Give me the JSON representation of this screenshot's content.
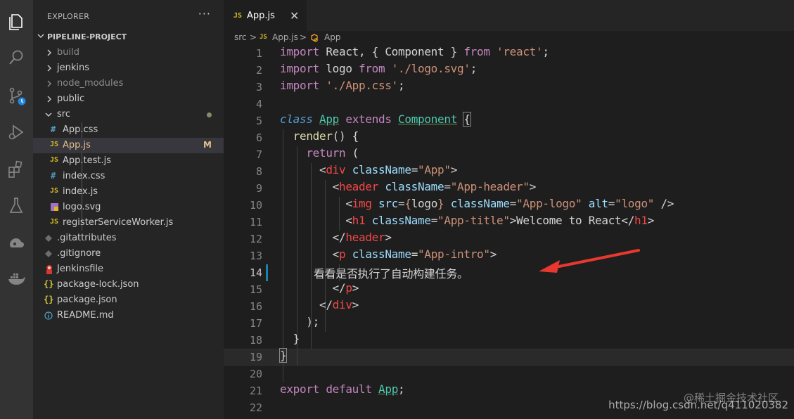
{
  "activity_bar": {
    "icons": [
      "files-icon",
      "search-icon",
      "source-control-icon",
      "run-debug-icon",
      "extensions-icon",
      "testing-icon",
      "database-icon",
      "docker-icon"
    ]
  },
  "explorer": {
    "header": "EXPLORER",
    "more": "···",
    "project": "PIPELINE-PROJECT",
    "items": [
      {
        "name": "build",
        "type": "folder",
        "state": "collapsed"
      },
      {
        "name": "jenkins",
        "type": "folder",
        "state": "collapsed"
      },
      {
        "name": "node_modules",
        "type": "folder",
        "state": "collapsed"
      },
      {
        "name": "public",
        "type": "folder",
        "state": "collapsed"
      },
      {
        "name": "src",
        "type": "folder",
        "state": "expanded"
      },
      {
        "name": "App.css",
        "type": "css",
        "icon": "#"
      },
      {
        "name": "App.js",
        "type": "js",
        "icon": "JS",
        "badge": "M"
      },
      {
        "name": "App.test.js",
        "type": "js",
        "icon": "JS"
      },
      {
        "name": "index.css",
        "type": "css",
        "icon": "#"
      },
      {
        "name": "index.js",
        "type": "js",
        "icon": "JS"
      },
      {
        "name": "logo.svg",
        "type": "svg"
      },
      {
        "name": "registerServiceWorker.js",
        "type": "js",
        "icon": "JS"
      },
      {
        "name": ".gitattributes",
        "type": "git"
      },
      {
        "name": ".gitignore",
        "type": "git"
      },
      {
        "name": "Jenkinsfile",
        "type": "jenkins"
      },
      {
        "name": "package-lock.json",
        "type": "json",
        "icon": "{}"
      },
      {
        "name": "package.json",
        "type": "json",
        "icon": "{}"
      },
      {
        "name": "README.md",
        "type": "info"
      }
    ]
  },
  "tab": {
    "icon": "JS",
    "name": "App.js",
    "close": "✕"
  },
  "breadcrumb": {
    "parts": [
      "src",
      ">",
      "JS",
      "App.js",
      ">",
      "App"
    ]
  },
  "editor": {
    "line_numbers": [
      "1",
      "2",
      "3",
      "4",
      "5",
      "6",
      "7",
      "8",
      "9",
      "10",
      "11",
      "12",
      "13",
      "14",
      "15",
      "16",
      "17",
      "18",
      "19",
      "20",
      "21",
      "22"
    ],
    "active_line": "14"
  },
  "watermark": {
    "line1": "@稀土掘金技术社区",
    "line2": "https://blog.csdn.net/q411020382"
  },
  "colors": {
    "accent_arrow": "#e8382f",
    "modified": "#e2c08d",
    "js_icon": "#d7ba26",
    "css_icon": "#519aba"
  }
}
